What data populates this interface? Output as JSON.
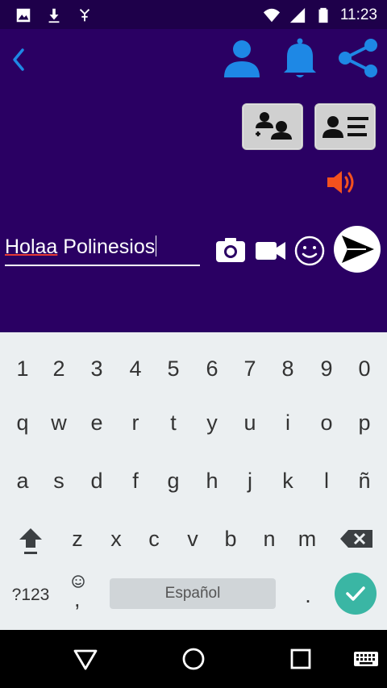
{
  "status_bar": {
    "time": "11:23",
    "icons_left": [
      "image-icon",
      "download-icon",
      "usb-debug-icon"
    ],
    "icons_right": [
      "wifi-icon",
      "signal-icon",
      "battery-icon"
    ]
  },
  "app": {
    "toolbar_icons": [
      "back-icon",
      "person-icon",
      "bell-icon",
      "share-icon"
    ],
    "message_input": {
      "value_underlined": "Holaa",
      "value_rest": " Polinesios"
    },
    "attach_icons": [
      "camera-icon",
      "video-icon",
      "emoji-icon",
      "send-icon"
    ],
    "colors": {
      "background": "#2a0063",
      "accent_blue": "#1e88e5",
      "speaker_red": "#f4511e"
    }
  },
  "keyboard": {
    "row_numbers": [
      "1",
      "2",
      "3",
      "4",
      "5",
      "6",
      "7",
      "8",
      "9",
      "0"
    ],
    "row_q": [
      "q",
      "w",
      "e",
      "r",
      "t",
      "y",
      "u",
      "i",
      "o",
      "p"
    ],
    "row_a": [
      "a",
      "s",
      "d",
      "f",
      "g",
      "h",
      "j",
      "k",
      "l",
      "ñ"
    ],
    "row_z": [
      "z",
      "x",
      "c",
      "v",
      "b",
      "n",
      "m"
    ],
    "symbols_label": "?123",
    "comma_label": ",",
    "space_label": "Español",
    "period_label": "."
  },
  "navbar": {
    "icons": [
      "nav-back-icon",
      "nav-home-icon",
      "nav-recents-icon",
      "keyboard-switch-icon"
    ]
  }
}
